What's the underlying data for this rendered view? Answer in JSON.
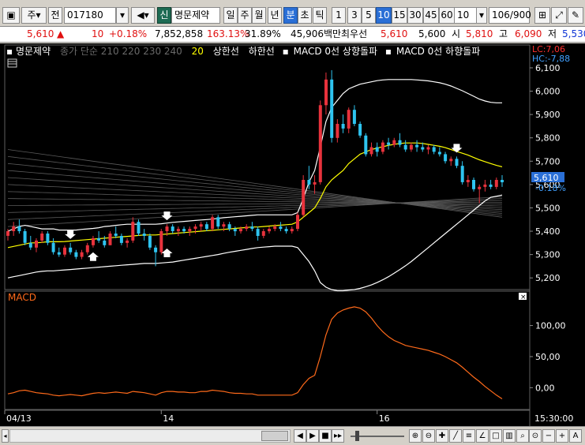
{
  "toolbar": {
    "market": "주",
    "type": "전",
    "code": "017180",
    "badge": "신",
    "stock_name": "명문제약",
    "period_buttons": [
      "일",
      "주",
      "월",
      "년",
      "분",
      "초",
      "틱"
    ],
    "interval_buttons": [
      "1",
      "3",
      "5",
      "10",
      "15",
      "30",
      "45",
      "60"
    ],
    "interval_value": "10",
    "count": "106/900"
  },
  "info": {
    "price": "5,610",
    "change": "10",
    "change_pct": "+0.18%",
    "volume": "7,852,858",
    "vol_ratio": "163.13%",
    "turnover": "31.89%",
    "amount": "45,906백만",
    "best_label": "최우선",
    "best_price": "5,610",
    "best_price2": "5,600",
    "open_label": "시",
    "open": "5,810",
    "high_label": "고",
    "high": "6,090",
    "low_label": "저",
    "low": "5,530"
  },
  "legend": {
    "name": "명문제약",
    "ma_text": "종가 단순 210  220  230  240",
    "ma20": "20",
    "upper": "상한선",
    "lower": "하한선",
    "macd_up": "MACD 0선 상향돌파",
    "macd_down": "MACD 0선 하향돌파"
  },
  "price_axis": {
    "ticks": [
      "6,100",
      "6,000",
      "5,900",
      "5,800",
      "5,700",
      "5,600",
      "5,500",
      "5,400",
      "5,300",
      "5,200"
    ],
    "lc": "LC:7,06",
    "hc": "HC:-7,88",
    "last_price": "5,610",
    "last_pct": "-0.18%"
  },
  "macd_panel": {
    "title": "MACD",
    "ticks": [
      "100,00",
      "50,00",
      "0,00"
    ]
  },
  "time_axis": {
    "labels": [
      "04/13",
      "14",
      "16"
    ],
    "clock": "15:30:00"
  },
  "colors": {
    "up": "#e8323c",
    "down": "#2ec4f0",
    "ma20": "#ffff00",
    "bollinger": "#ffffff",
    "macd": "#ff6a1a"
  },
  "chart_data": {
    "type": "candlestick",
    "title": "명문제약",
    "ylim": [
      5150,
      6110
    ],
    "macd_ylim": [
      -30,
      135
    ],
    "candles": [
      [
        5380,
        5410,
        5360,
        5400
      ],
      [
        5400,
        5440,
        5380,
        5420
      ],
      [
        5420,
        5450,
        5390,
        5400
      ],
      [
        5400,
        5410,
        5340,
        5350
      ],
      [
        5350,
        5380,
        5320,
        5330
      ],
      [
        5330,
        5370,
        5310,
        5360
      ],
      [
        5360,
        5400,
        5350,
        5390
      ],
      [
        5390,
        5400,
        5340,
        5350
      ],
      [
        5350,
        5370,
        5300,
        5310
      ],
      [
        5310,
        5330,
        5290,
        5300
      ],
      [
        5300,
        5340,
        5290,
        5330
      ],
      [
        5330,
        5350,
        5300,
        5310
      ],
      [
        5310,
        5320,
        5280,
        5290
      ],
      [
        5290,
        5320,
        5280,
        5310
      ],
      [
        5310,
        5350,
        5300,
        5340
      ],
      [
        5340,
        5380,
        5330,
        5370
      ],
      [
        5370,
        5400,
        5350,
        5360
      ],
      [
        5360,
        5380,
        5330,
        5340
      ],
      [
        5340,
        5400,
        5340,
        5390
      ],
      [
        5390,
        5420,
        5370,
        5380
      ],
      [
        5380,
        5390,
        5340,
        5350
      ],
      [
        5350,
        5370,
        5330,
        5360
      ],
      [
        5360,
        5460,
        5350,
        5440
      ],
      [
        5440,
        5450,
        5380,
        5390
      ],
      [
        5390,
        5410,
        5360,
        5380
      ],
      [
        5380,
        5390,
        5320,
        5330
      ],
      [
        5330,
        5340,
        5250,
        5310
      ],
      [
        5310,
        5410,
        5300,
        5400
      ],
      [
        5400,
        5430,
        5380,
        5420
      ],
      [
        5420,
        5430,
        5390,
        5400
      ],
      [
        5400,
        5420,
        5380,
        5410
      ],
      [
        5410,
        5420,
        5390,
        5400
      ],
      [
        5400,
        5420,
        5380,
        5410
      ],
      [
        5410,
        5430,
        5390,
        5420
      ],
      [
        5420,
        5440,
        5400,
        5430
      ],
      [
        5430,
        5440,
        5400,
        5410
      ],
      [
        5410,
        5470,
        5400,
        5460
      ],
      [
        5460,
        5470,
        5410,
        5420
      ],
      [
        5420,
        5440,
        5400,
        5430
      ],
      [
        5430,
        5440,
        5400,
        5410
      ],
      [
        5410,
        5420,
        5380,
        5400
      ],
      [
        5400,
        5420,
        5390,
        5410
      ],
      [
        5410,
        5430,
        5400,
        5420
      ],
      [
        5420,
        5440,
        5400,
        5410
      ],
      [
        5410,
        5420,
        5360,
        5380
      ],
      [
        5380,
        5410,
        5370,
        5400
      ],
      [
        5400,
        5420,
        5390,
        5410
      ],
      [
        5410,
        5430,
        5400,
        5420
      ],
      [
        5420,
        5440,
        5400,
        5410
      ],
      [
        5410,
        5420,
        5390,
        5400
      ],
      [
        5400,
        5420,
        5390,
        5410
      ],
      [
        5410,
        5480,
        5400,
        5470
      ],
      [
        5470,
        5640,
        5460,
        5620
      ],
      [
        5620,
        5680,
        5580,
        5600
      ],
      [
        5600,
        5640,
        5560,
        5610
      ],
      [
        5610,
        5960,
        5600,
        5940
      ],
      [
        5940,
        6080,
        5900,
        6050
      ],
      [
        6050,
        6090,
        5780,
        5800
      ],
      [
        5800,
        5880,
        5780,
        5860
      ],
      [
        5860,
        5900,
        5820,
        5840
      ],
      [
        5840,
        5930,
        5820,
        5920
      ],
      [
        5920,
        5940,
        5850,
        5860
      ],
      [
        5860,
        5870,
        5800,
        5810
      ],
      [
        5810,
        5820,
        5720,
        5730
      ],
      [
        5730,
        5780,
        5720,
        5760
      ],
      [
        5760,
        5780,
        5720,
        5740
      ],
      [
        5740,
        5790,
        5730,
        5780
      ],
      [
        5780,
        5800,
        5750,
        5770
      ],
      [
        5770,
        5800,
        5760,
        5790
      ],
      [
        5790,
        5820,
        5760,
        5770
      ],
      [
        5770,
        5790,
        5740,
        5750
      ],
      [
        5750,
        5780,
        5740,
        5770
      ],
      [
        5770,
        5790,
        5740,
        5760
      ],
      [
        5760,
        5780,
        5740,
        5750
      ],
      [
        5750,
        5770,
        5730,
        5760
      ],
      [
        5760,
        5770,
        5730,
        5740
      ],
      [
        5740,
        5760,
        5720,
        5730
      ],
      [
        5730,
        5740,
        5690,
        5700
      ],
      [
        5700,
        5720,
        5680,
        5710
      ],
      [
        5710,
        5720,
        5670,
        5680
      ],
      [
        5680,
        5700,
        5600,
        5610
      ],
      [
        5610,
        5640,
        5590,
        5620
      ],
      [
        5620,
        5630,
        5570,
        5580
      ],
      [
        5580,
        5600,
        5520,
        5590
      ],
      [
        5590,
        5620,
        5570,
        5600
      ],
      [
        5600,
        5620,
        5580,
        5590
      ],
      [
        5590,
        5630,
        5580,
        5620
      ],
      [
        5620,
        5640,
        5590,
        5610
      ]
    ],
    "ma20": [
      5330,
      5335,
      5340,
      5345,
      5350,
      5350,
      5352,
      5355,
      5355,
      5355,
      5356,
      5358,
      5360,
      5362,
      5364,
      5366,
      5368,
      5370,
      5372,
      5374,
      5376,
      5378,
      5380,
      5382,
      5384,
      5384,
      5384,
      5386,
      5388,
      5390,
      5392,
      5394,
      5396,
      5398,
      5400,
      5402,
      5404,
      5406,
      5408,
      5410,
      5412,
      5414,
      5416,
      5418,
      5418,
      5420,
      5422,
      5424,
      5426,
      5428,
      5430,
      5440,
      5460,
      5480,
      5500,
      5540,
      5590,
      5620,
      5640,
      5660,
      5690,
      5710,
      5730,
      5740,
      5750,
      5756,
      5762,
      5768,
      5772,
      5776,
      5778,
      5778,
      5778,
      5776,
      5772,
      5768,
      5764,
      5758,
      5750,
      5742,
      5734,
      5726,
      5716,
      5706,
      5698,
      5690,
      5682,
      5676
    ],
    "bb_upper": [
      5400,
      5410,
      5420,
      5425,
      5420,
      5415,
      5410,
      5410,
      5410,
      5405,
      5405,
      5405,
      5405,
      5408,
      5410,
      5412,
      5415,
      5420,
      5422,
      5425,
      5428,
      5430,
      5430,
      5430,
      5430,
      5430,
      5430,
      5432,
      5435,
      5438,
      5440,
      5442,
      5444,
      5446,
      5448,
      5450,
      5452,
      5455,
      5458,
      5460,
      5462,
      5464,
      5466,
      5468,
      5470,
      5470,
      5470,
      5470,
      5470,
      5470,
      5470,
      5480,
      5540,
      5610,
      5660,
      5760,
      5870,
      5930,
      5960,
      5990,
      6010,
      6020,
      6030,
      6035,
      6040,
      6045,
      6048,
      6050,
      6050,
      6050,
      6050,
      6050,
      6048,
      6046,
      6044,
      6040,
      6036,
      6030,
      6022,
      6012,
      6002,
      5990,
      5978,
      5966,
      5958,
      5952,
      5950,
      5950
    ],
    "bb_lower": [
      5200,
      5205,
      5210,
      5215,
      5220,
      5225,
      5228,
      5230,
      5230,
      5232,
      5234,
      5236,
      5238,
      5240,
      5242,
      5244,
      5246,
      5248,
      5250,
      5252,
      5254,
      5256,
      5258,
      5260,
      5262,
      5262,
      5262,
      5264,
      5266,
      5268,
      5272,
      5276,
      5280,
      5284,
      5288,
      5292,
      5296,
      5300,
      5305,
      5310,
      5314,
      5318,
      5322,
      5326,
      5330,
      5332,
      5334,
      5336,
      5336,
      5336,
      5336,
      5330,
      5300,
      5270,
      5230,
      5180,
      5160,
      5150,
      5145,
      5145,
      5148,
      5150,
      5155,
      5162,
      5170,
      5180,
      5192,
      5205,
      5220,
      5236,
      5252,
      5270,
      5290,
      5310,
      5330,
      5350,
      5370,
      5390,
      5410,
      5430,
      5450,
      5470,
      5490,
      5510,
      5530,
      5545,
      5550,
      5555
    ],
    "macd": [
      -10,
      -8,
      -5,
      -4,
      -6,
      -8,
      -9,
      -10,
      -12,
      -13,
      -12,
      -11,
      -12,
      -13,
      -11,
      -9,
      -8,
      -9,
      -8,
      -7,
      -8,
      -9,
      -6,
      -7,
      -8,
      -10,
      -12,
      -8,
      -6,
      -6,
      -7,
      -7,
      -8,
      -8,
      -6,
      -6,
      -4,
      -5,
      -6,
      -8,
      -9,
      -9,
      -10,
      -10,
      -12,
      -12,
      -12,
      -12,
      -12,
      -12,
      -12,
      -8,
      5,
      15,
      20,
      50,
      85,
      110,
      120,
      125,
      128,
      130,
      128,
      122,
      112,
      100,
      90,
      82,
      76,
      72,
      68,
      66,
      64,
      62,
      60,
      57,
      54,
      50,
      45,
      40,
      33,
      25,
      17,
      10,
      2,
      -5,
      -12,
      -18
    ]
  }
}
